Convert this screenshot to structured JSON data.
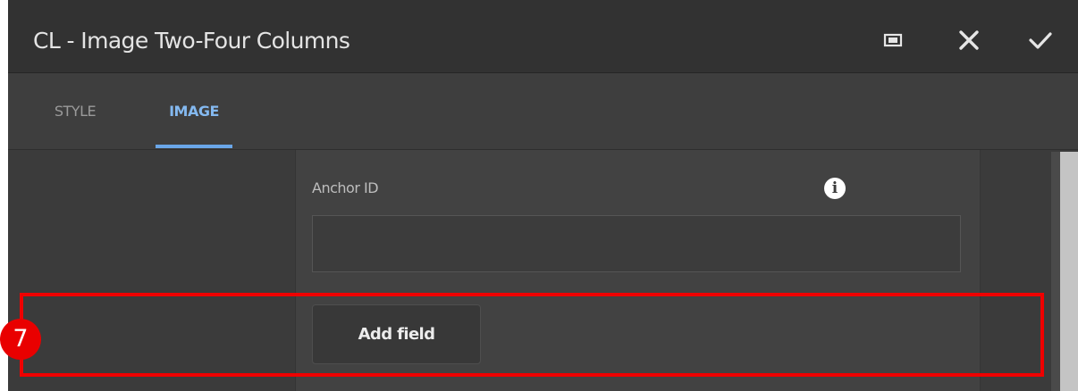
{
  "dialog": {
    "title": "CL - Image Two-Four Columns",
    "actions": [
      {
        "name": "fullscreen-icon"
      },
      {
        "name": "close-icon"
      },
      {
        "name": "confirm-check-icon"
      }
    ]
  },
  "tabs": [
    {
      "label": "STYLE",
      "active": false
    },
    {
      "label": "IMAGE",
      "active": true
    }
  ],
  "form": {
    "anchor_label": "Anchor ID",
    "anchor_value": "",
    "info_icon": "info-icon",
    "info_glyph": "i",
    "add_field_label": "Add field"
  },
  "annotation": {
    "step_number": "7",
    "color": "#ef0000"
  },
  "colors": {
    "accent": "#84b9f0",
    "dialog_bg": "#3b3b3b",
    "titlebar_bg": "#323232"
  }
}
